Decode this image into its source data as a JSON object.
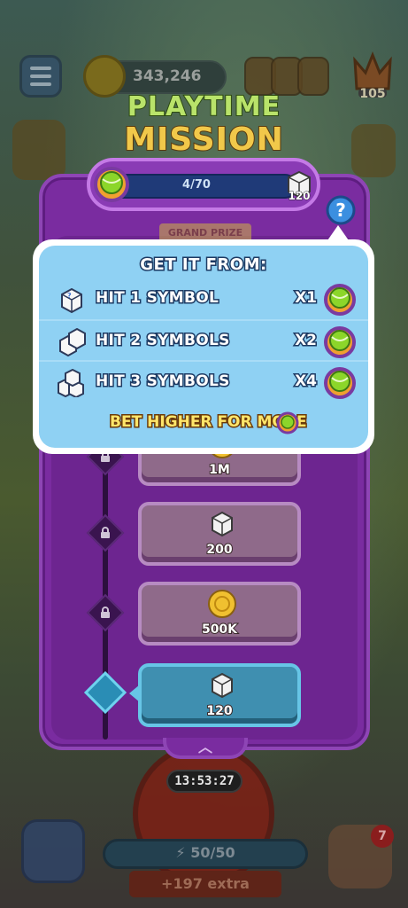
{
  "hud": {
    "coins": "343,246",
    "crown_level": "105",
    "notification_count": "7"
  },
  "title": {
    "line1": "PLAYTIME",
    "line2": "MISSION"
  },
  "progress": {
    "current": 4,
    "target": 70,
    "label": "4/70",
    "dice_reward": "120"
  },
  "grand_prize_label": "GRAND PRIZE",
  "popup": {
    "title": "GET IT FROM:",
    "rows": [
      {
        "label": "HIT 1 SYMBOL",
        "multiplier": "X1"
      },
      {
        "label": "HIT 2 SYMBOLS",
        "multiplier": "X2"
      },
      {
        "label": "HIT 3 SYMBOLS",
        "multiplier": "X4"
      }
    ],
    "footer": "BET HIGHER FOR MORE"
  },
  "rewards": [
    {
      "label": "1M",
      "icon": "coin-icon"
    },
    {
      "label": "200",
      "icon": "dice-icon"
    },
    {
      "label": "500K",
      "icon": "coin-icon"
    },
    {
      "label": "120",
      "icon": "dice-icon",
      "active": true
    }
  ],
  "timer": "13:53:27",
  "energy": "50/50",
  "extra": "+197 extra",
  "colors": {
    "panel": "#7a2ca0",
    "popup_bg": "#8fd1f3",
    "text_outline": "#1d3a63",
    "bet_text": "#ffe66a"
  }
}
